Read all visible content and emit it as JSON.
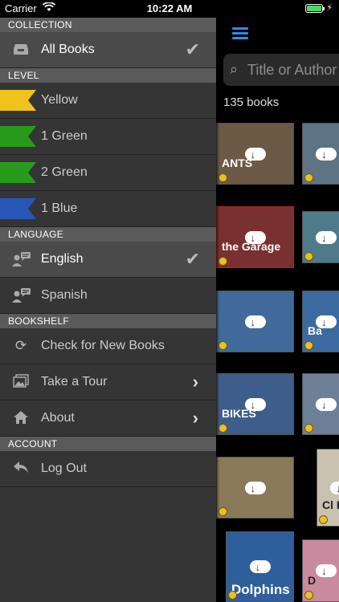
{
  "status_bar": {
    "carrier": "Carrier",
    "time": "10:22 AM"
  },
  "sidebar": {
    "collection": {
      "header": "COLLECTION",
      "items": [
        {
          "label": "All Books",
          "icon": "inbox-tray-icon",
          "selected": true
        }
      ]
    },
    "level": {
      "header": "LEVEL",
      "items": [
        {
          "label": "Yellow",
          "color": "#f0c21c"
        },
        {
          "label": "1 Green",
          "color": "#279b1c"
        },
        {
          "label": "2 Green",
          "color": "#279b1c"
        },
        {
          "label": "1 Blue",
          "color": "#2a56b8"
        }
      ]
    },
    "language": {
      "header": "LANGUAGE",
      "items": [
        {
          "label": "English",
          "icon": "speaking-person-icon",
          "selected": true
        },
        {
          "label": "Spanish",
          "icon": "speaking-person-icon",
          "selected": false
        }
      ]
    },
    "bookshelf": {
      "header": "BOOKSHELF",
      "items": [
        {
          "label": "Check for New Books",
          "icon": "refresh-icon"
        },
        {
          "label": "Take a Tour",
          "icon": "photos-icon"
        },
        {
          "label": "About",
          "icon": "home-icon"
        }
      ]
    },
    "account": {
      "header": "ACCOUNT",
      "items": [
        {
          "label": "Log Out",
          "icon": "reply-arrow-icon"
        }
      ]
    }
  },
  "main": {
    "menu_icon": "hamburger-menu-icon",
    "search": {
      "placeholder": "Title or Author"
    },
    "book_count": "135 books",
    "covers": [
      {
        "title": "ANTS",
        "bg": "#6b5a45"
      },
      {
        "title": "",
        "bg": "#5e7384"
      },
      {
        "title": "the Garage",
        "bg": "#7a3030"
      },
      {
        "title": "",
        "bg": "#4f7a8a"
      },
      {
        "title": "",
        "bg": "#3f6a9a"
      },
      {
        "title": "Ba",
        "bg": "#3a6aa0"
      },
      {
        "title": "BIKES",
        "bg": "#3d5e8a"
      },
      {
        "title": "",
        "bg": "#6e8098"
      },
      {
        "title": "",
        "bg": "#8a7a5a"
      },
      {
        "title": "Cl Ho",
        "bg": "#c9c2b0"
      },
      {
        "title": "Dolphins",
        "bg": "#2f5f9a"
      },
      {
        "title": "D",
        "bg": "#c98aa0"
      }
    ]
  },
  "accent": "#2e8be8"
}
